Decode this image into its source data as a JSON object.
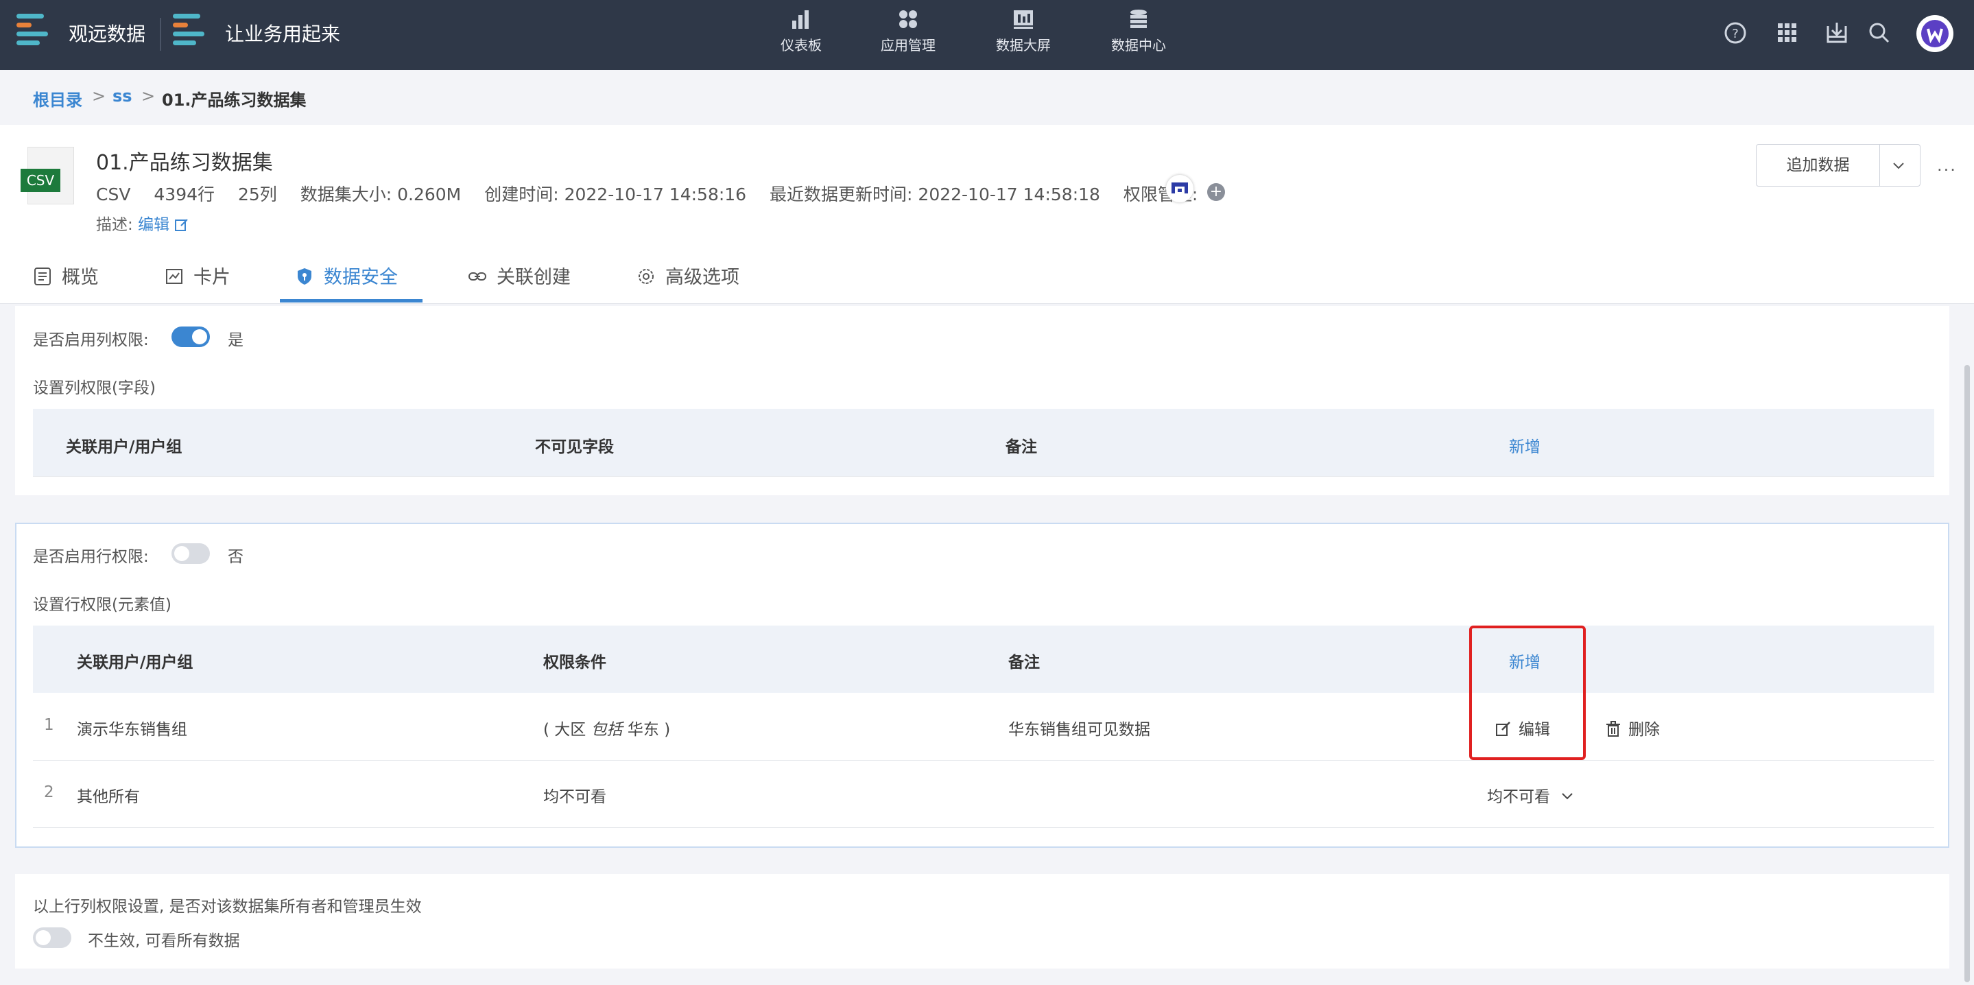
{
  "topbar": {
    "brand1": "观远数据",
    "brand2": "让业务用起来",
    "nav": [
      {
        "label": "仪表板",
        "icon": "bar-chart-icon"
      },
      {
        "label": "应用管理",
        "icon": "apps-icon"
      },
      {
        "label": "数据大屏",
        "icon": "screen-icon"
      },
      {
        "label": "数据中心",
        "icon": "database-icon"
      }
    ],
    "right_icons": [
      "help-icon",
      "grid-icon",
      "download-icon",
      "search-icon",
      "avatar"
    ]
  },
  "breadcrumb": {
    "root": "根目录",
    "sep": ">",
    "folder": "ss",
    "current": "01.产品练习数据集"
  },
  "dataset": {
    "file_type": "CSV",
    "title": "01.产品练习数据集",
    "type": "CSV",
    "rows": "4394行",
    "cols": "25列",
    "size": "数据集大小: 0.260M",
    "created": "创建时间: 2022-10-17 14:58:16",
    "updated": "最近数据更新时间: 2022-10-17 14:58:18",
    "perm_label": "权限管理:",
    "desc_label": "描述:",
    "edit": "编辑",
    "add_data": "追加数据"
  },
  "tabs": [
    {
      "label": "概览",
      "active": false
    },
    {
      "label": "卡片",
      "active": false
    },
    {
      "label": "数据安全",
      "active": true
    },
    {
      "label": "关联创建",
      "active": false
    },
    {
      "label": "高级选项",
      "active": false
    }
  ],
  "column_perm": {
    "enable_label": "是否启用列权限:",
    "enabled": true,
    "state": "是",
    "section": "设置列权限(字段)",
    "headers": [
      "关联用户/用户组",
      "不可见字段",
      "备注",
      "新增"
    ]
  },
  "row_perm": {
    "enable_label": "是否启用行权限:",
    "enabled": false,
    "state": "否",
    "section": "设置行权限(元素值)",
    "headers": [
      "关联用户/用户组",
      "权限条件",
      "备注",
      "新增"
    ],
    "rows": [
      {
        "idx": "1",
        "user": "演示华东销售组",
        "cond_open": "( 大区",
        "cond_op": "包括",
        "cond_val": "华东 )",
        "note": "华东销售组可见数据",
        "edit": "编辑",
        "delete": "删除"
      },
      {
        "idx": "2",
        "user": "其他所有",
        "cond": "均不可看",
        "note": "",
        "select": "均不可看"
      }
    ]
  },
  "owner_setting": {
    "question": "以上行列权限设置, 是否对该数据集所有者和管理员生效",
    "enabled": false,
    "state": "不生效, 可看所有数据"
  },
  "colors": {
    "accent": "#3b86d1",
    "topbar": "#2f3848",
    "highlight": "#e02020"
  }
}
